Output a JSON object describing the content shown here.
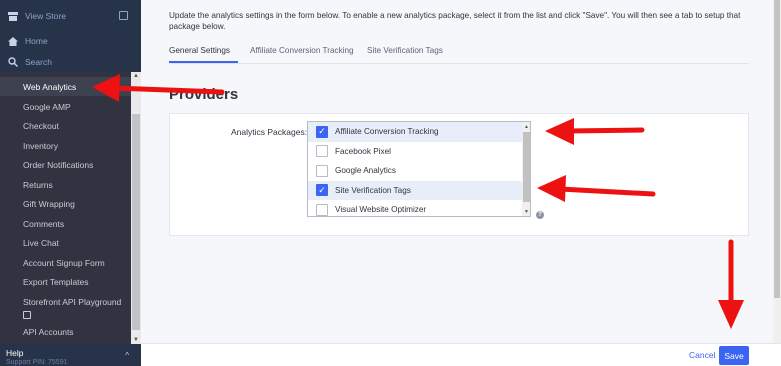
{
  "sidebar": {
    "top_items": [
      {
        "label": "View Store",
        "icon": "store-icon"
      },
      {
        "label": "Home",
        "icon": "home-icon"
      },
      {
        "label": "Search",
        "icon": "search-icon"
      }
    ],
    "items": [
      {
        "label": "Web Analytics",
        "active": true
      },
      {
        "label": "Google AMP"
      },
      {
        "label": "Checkout"
      },
      {
        "label": "Inventory"
      },
      {
        "label": "Order Notifications"
      },
      {
        "label": "Returns"
      },
      {
        "label": "Gift Wrapping"
      },
      {
        "label": "Comments"
      },
      {
        "label": "Live Chat"
      },
      {
        "label": "Account Signup Form"
      },
      {
        "label": "Export Templates"
      },
      {
        "label": "Storefront API Playground"
      },
      {
        "label": "API Accounts"
      }
    ],
    "help_label": "Help",
    "support_pin": "Support PIN: 75591"
  },
  "main": {
    "description": "Update the analytics settings in the form below. To enable a new analytics package, select it from the list and click \"Save\". You will then see a tab to setup that package below.",
    "tabs": [
      {
        "label": "General Settings",
        "active": true
      },
      {
        "label": "Affiliate Conversion Tracking"
      },
      {
        "label": "Site Verification Tags"
      }
    ],
    "section_title": "Providers",
    "field_label": "Analytics Packages:",
    "packages": [
      {
        "label": "Affiliate Conversion Tracking",
        "checked": true
      },
      {
        "label": "Facebook Pixel",
        "checked": false
      },
      {
        "label": "Google Analytics",
        "checked": false
      },
      {
        "label": "Site Verification Tags",
        "checked": true
      },
      {
        "label": "Visual Website Optimizer",
        "checked": false
      }
    ]
  },
  "footer": {
    "cancel_label": "Cancel",
    "save_label": "Save"
  },
  "colors": {
    "accent": "#3c64f4",
    "sidebar_bg": "#313440",
    "sidebar_top_bg": "#263349",
    "annotation_arrow": "#ee1111"
  }
}
